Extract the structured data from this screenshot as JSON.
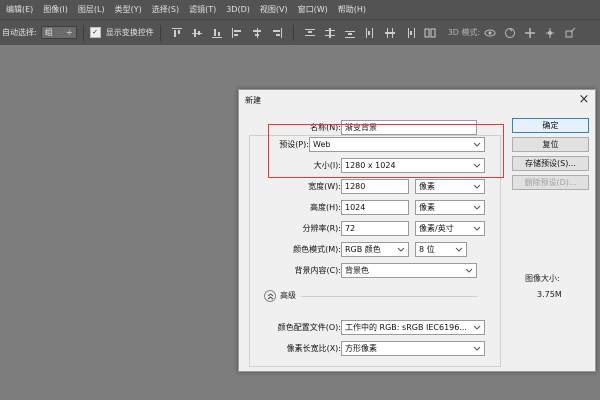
{
  "menubar": {
    "items": [
      "编辑(E)",
      "图像(I)",
      "图层(L)",
      "类型(Y)",
      "选择(S)",
      "滤镜(T)",
      "3D(D)",
      "视图(V)",
      "窗口(W)",
      "帮助(H)"
    ]
  },
  "options": {
    "auto_select_label": "自动选择:",
    "auto_select_value": "组",
    "show_transform_label": "显示变换控件",
    "mode_label": "3D 模式:"
  },
  "dialog": {
    "title": "新建",
    "fields": {
      "name": {
        "label": "名称(N):",
        "value": "渐变背景"
      },
      "preset": {
        "label": "预设(P):",
        "value": "Web"
      },
      "size": {
        "label": "大小(I):",
        "value": "1280 x 1024"
      },
      "width": {
        "label": "宽度(W):",
        "value": "1280",
        "unit": "像素"
      },
      "height": {
        "label": "高度(H):",
        "value": "1024",
        "unit": "像素"
      },
      "resolution": {
        "label": "分辨率(R):",
        "value": "72",
        "unit": "像素/英寸"
      },
      "color_mode": {
        "label": "颜色模式(M):",
        "value": "RGB 颜色",
        "depth": "8 位"
      },
      "background": {
        "label": "背景内容(C):",
        "value": "背景色"
      },
      "color_profile": {
        "label": "颜色配置文件(O):",
        "value": "工作中的 RGB: sRGB IEC6196..."
      },
      "pixel_aspect": {
        "label": "像素长宽比(X):",
        "value": "方形像素"
      }
    },
    "advanced_label": "高级",
    "buttons": {
      "ok": "确定",
      "reset": "复位",
      "save_preset": "存储预设(S)...",
      "delete_preset": "删除预设(D)..."
    },
    "image_size_label": "图像大小:",
    "image_size_value": "3.75M"
  },
  "colors": {
    "workspace": "#7d7d7d",
    "toolbar": "#535353",
    "dialog": "#f0f0f0",
    "highlight": "#e53935",
    "primary_button_border": "#3c7fb1"
  }
}
